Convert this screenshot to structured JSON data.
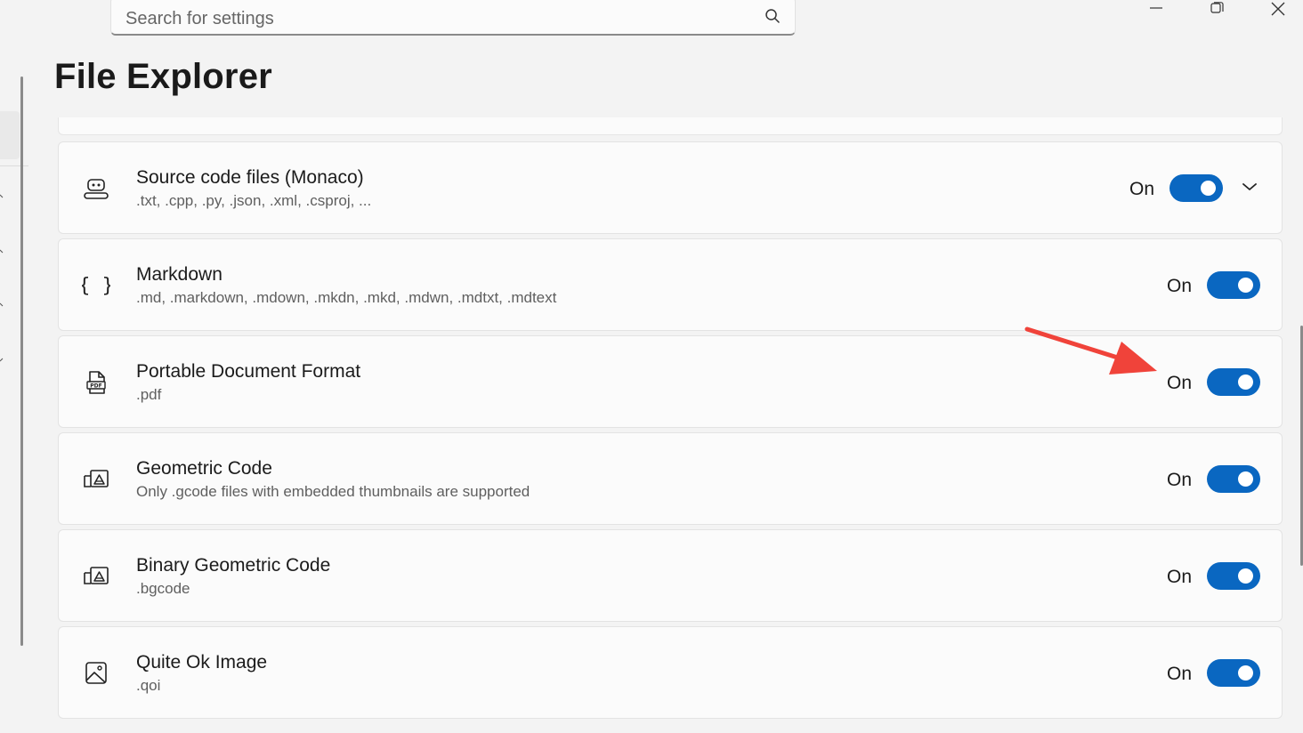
{
  "search": {
    "placeholder": "Search for settings"
  },
  "page": {
    "title": "File Explorer"
  },
  "accent": "#0a67c1",
  "annotation_color": "#f0433a",
  "items": [
    {
      "label": "Source code files (Monaco)",
      "desc": ".txt, .cpp, .py, .json, .xml, .csproj, ...",
      "state": "On",
      "icon": "robot-icon",
      "expandable": true
    },
    {
      "label": "Markdown",
      "desc": ".md, .markdown, .mdown, .mkdn, .mkd, .mdwn, .mdtxt, .mdtext",
      "state": "On",
      "icon": "braces-icon"
    },
    {
      "label": "Portable Document Format",
      "desc": ".pdf",
      "state": "On",
      "icon": "pdf-file-icon"
    },
    {
      "label": "Geometric Code",
      "desc": "Only .gcode files with embedded thumbnails are supported",
      "state": "On",
      "icon": "gcode-icon"
    },
    {
      "label": "Binary Geometric Code",
      "desc": ".bgcode",
      "state": "On",
      "icon": "gcode-icon"
    },
    {
      "label": "Quite Ok Image",
      "desc": ".qoi",
      "state": "On",
      "icon": "image-icon"
    }
  ]
}
